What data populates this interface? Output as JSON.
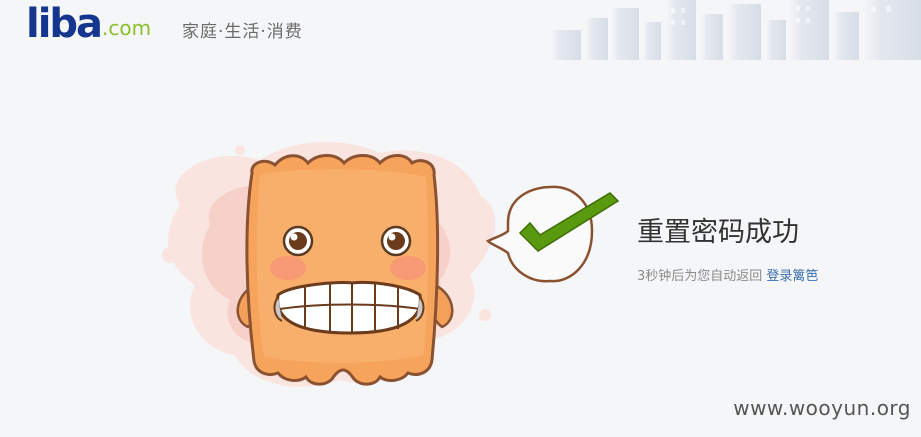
{
  "brand": {
    "logo_main": "liba",
    "logo_suffix": ".com",
    "slogan": "家庭·生活·消费",
    "primary_color": "#15368e",
    "accent_color": "#8bbf2b"
  },
  "message": {
    "title": "重置密码成功",
    "countdown_text": "3秒钟后为您自动返回",
    "return_link": "登录篱笆",
    "link_color": "#3a6fb0"
  },
  "illustration": {
    "mascot": "smiling-orange-mascot",
    "bubble_icon": "checkmark-icon",
    "check_color": "#5a9a0e"
  },
  "watermark": "www.wooyun.org"
}
